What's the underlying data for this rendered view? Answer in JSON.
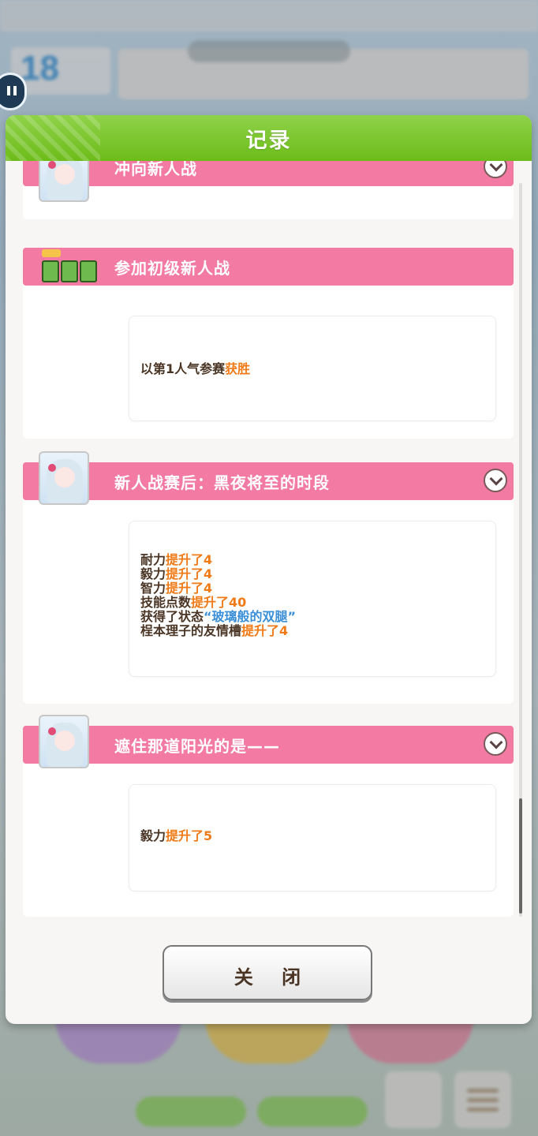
{
  "dialog": {
    "title": "记录",
    "close_label": "关 闭"
  },
  "entries": [
    {
      "title": "冲向新人战",
      "icon": "character-portrait-icon",
      "lines": []
    },
    {
      "title": "参加初级新人战",
      "icon": "race-trophy-icon",
      "lines": [
        {
          "text": "以第1人气参赛",
          "highlight": "获胜"
        }
      ]
    },
    {
      "title": "新人战赛后：黑夜将至的时段",
      "icon": "character-portrait-icon",
      "lines": [
        {
          "text": "耐力",
          "highlight": "提升了4"
        },
        {
          "text": "毅力",
          "highlight": "提升了4"
        },
        {
          "text": "智力",
          "highlight": "提升了4"
        },
        {
          "text": "技能点数",
          "highlight": "提升了40"
        },
        {
          "text": "获得了状态",
          "highlight_blue": "“玻璃般的双腿”"
        },
        {
          "text": "桯本理子的友情槽",
          "highlight": "提升了4"
        }
      ]
    },
    {
      "title": "遮住那道阳光的是——",
      "icon": "character-portrait-icon",
      "lines": [
        {
          "text": "毅力",
          "highlight": "提升了5"
        }
      ]
    }
  ],
  "background": {
    "date_number": "18"
  },
  "colors": {
    "header_green": "#6cbc19",
    "card_pink": "#f27aa3",
    "highlight_orange": "#f07a16",
    "highlight_blue": "#3a8fd8"
  }
}
